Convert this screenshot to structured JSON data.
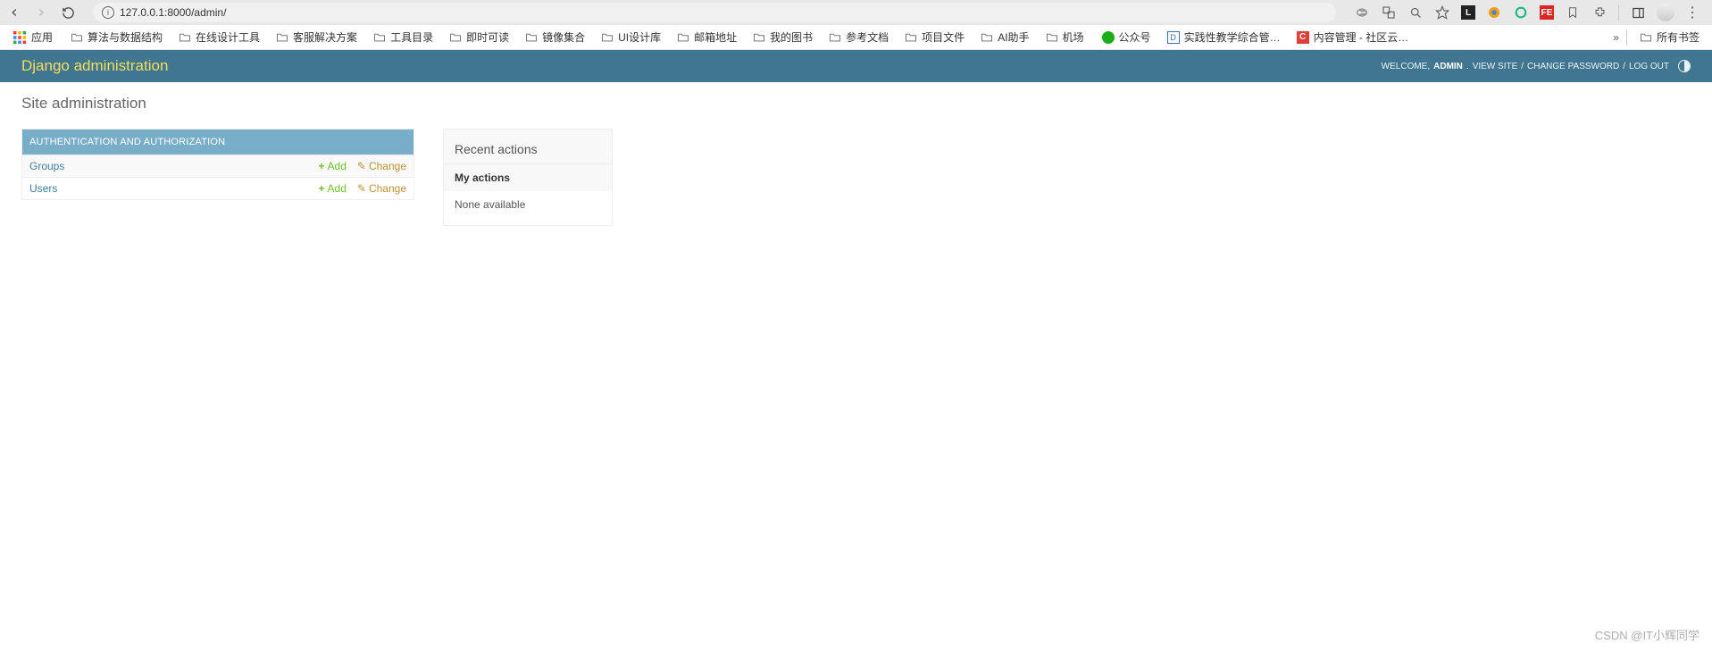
{
  "browser": {
    "url": "127.0.0.1:8000/admin/"
  },
  "bookmarks": {
    "apps_label": "应用",
    "items": [
      "算法与数据结构",
      "在线设计工具",
      "客服解决方案",
      "工具目录",
      "即时可读",
      "镜像集合",
      "UI设计库",
      "邮箱地址",
      "我的图书",
      "参考文档",
      "项目文件",
      "AI助手",
      "机场"
    ],
    "special": [
      {
        "label": "公众号",
        "color": "#1aad19",
        "type": "circle"
      },
      {
        "label": "实践性教学综合管…",
        "color": "#3b6fb6",
        "type": "doc"
      },
      {
        "label": "内容管理 - 社区云…",
        "color": "#e03e36",
        "type": "square",
        "letter": "C"
      }
    ],
    "all_label": "所有书签"
  },
  "header": {
    "branding": "Django administration",
    "welcome": "WELCOME,",
    "username": "ADMIN",
    "view_site": "VIEW SITE",
    "change_password": "CHANGE PASSWORD",
    "logout": "LOG OUT"
  },
  "page": {
    "title": "Site administration"
  },
  "module": {
    "caption": "AUTHENTICATION AND AUTHORIZATION",
    "models": [
      {
        "name": "Groups",
        "add": "Add",
        "change": "Change"
      },
      {
        "name": "Users",
        "add": "Add",
        "change": "Change"
      }
    ]
  },
  "sidebar": {
    "recent_title": "Recent actions",
    "my_actions": "My actions",
    "none": "None available"
  },
  "watermark": "CSDN @IT小辉同学"
}
